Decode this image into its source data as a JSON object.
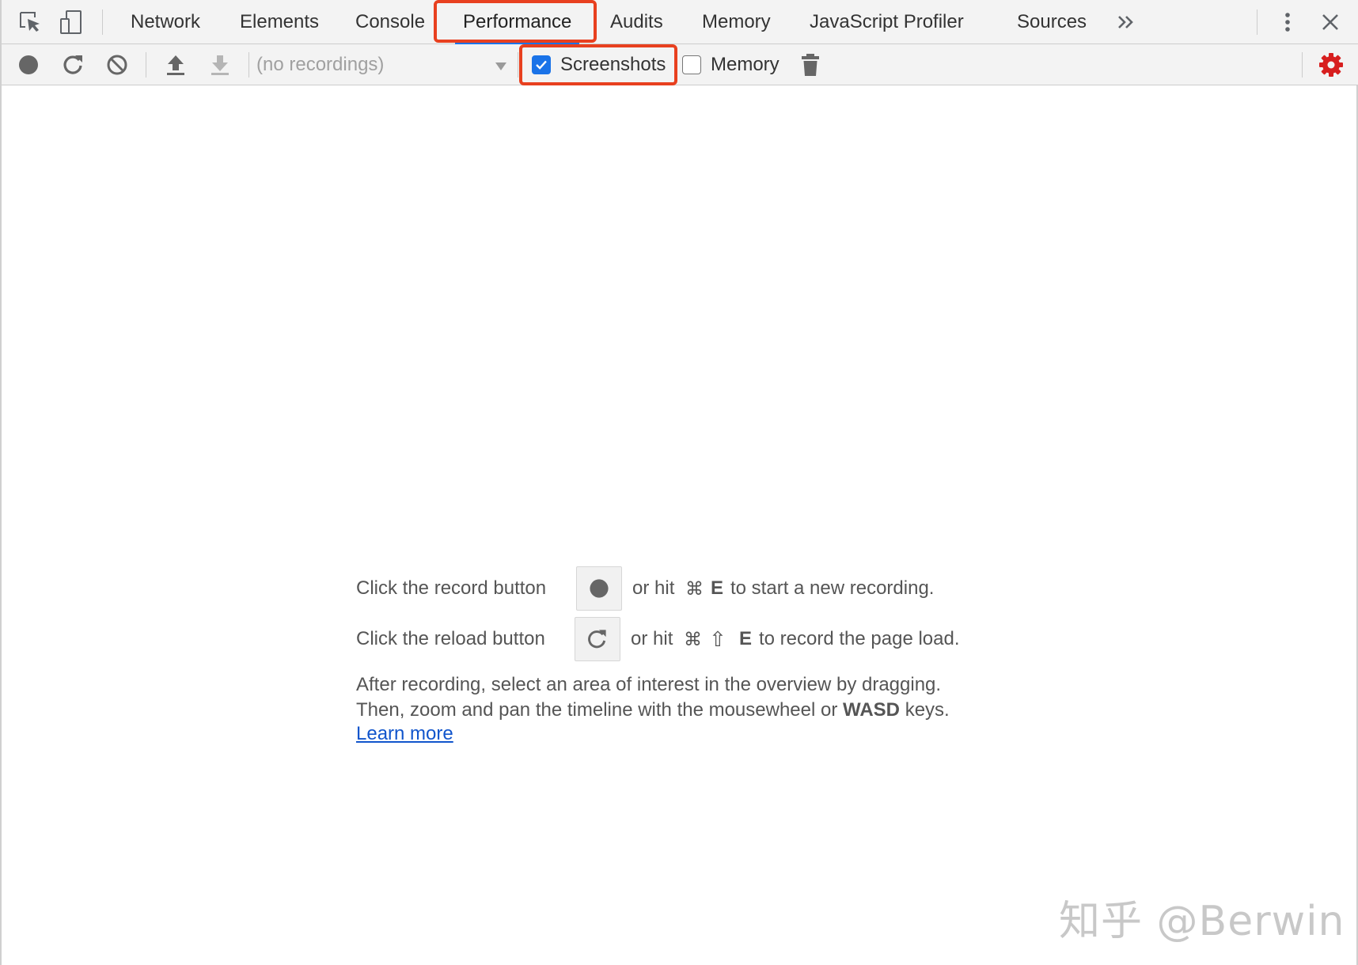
{
  "tabs": [
    {
      "label": "Network"
    },
    {
      "label": "Elements"
    },
    {
      "label": "Console"
    },
    {
      "label": "Performance",
      "active": true
    },
    {
      "label": "Audits"
    },
    {
      "label": "Memory"
    },
    {
      "label": "JavaScript Profiler"
    },
    {
      "label": "Sources"
    }
  ],
  "tabbar_icons": [
    "select-element-icon",
    "device-toolbar-icon",
    "more-tabs-icon",
    "kebab-menu-icon",
    "close-icon"
  ],
  "toolbar": {
    "icons": [
      "record-icon",
      "reload-icon",
      "clear-icon",
      "load-profile-icon",
      "save-profile-icon",
      "trash-icon",
      "settings-icon"
    ],
    "recordings_select": "(no recordings)",
    "screenshots_label": "Screenshots",
    "screenshots_checked": true,
    "memory_label": "Memory",
    "memory_checked": false
  },
  "landing": {
    "record_prefix": "Click the record button",
    "record_suffix_pre": "or hit",
    "record_cmd": "⌘",
    "record_key": "E",
    "record_suffix_post": "to start a new recording.",
    "reload_prefix": "Click the reload button",
    "reload_suffix_pre": "or hit",
    "reload_cmd": "⌘",
    "reload_shift": "⇧",
    "reload_key": "E",
    "reload_suffix_post": "to record the page load.",
    "para_line1": "After recording, select an area of interest in the overview by dragging.",
    "para_line2_pre": "Then, zoom and pan the timeline with the mousewheel or",
    "para_line2_keys": "WASD",
    "para_line2_post": "keys.",
    "learn_more": "Learn more"
  },
  "watermark": "知乎 @Berwin",
  "colors": {
    "highlight": "#e8401f",
    "accent": "#1a73e8",
    "settings_red": "#d71f1f",
    "link": "#1155cc"
  }
}
